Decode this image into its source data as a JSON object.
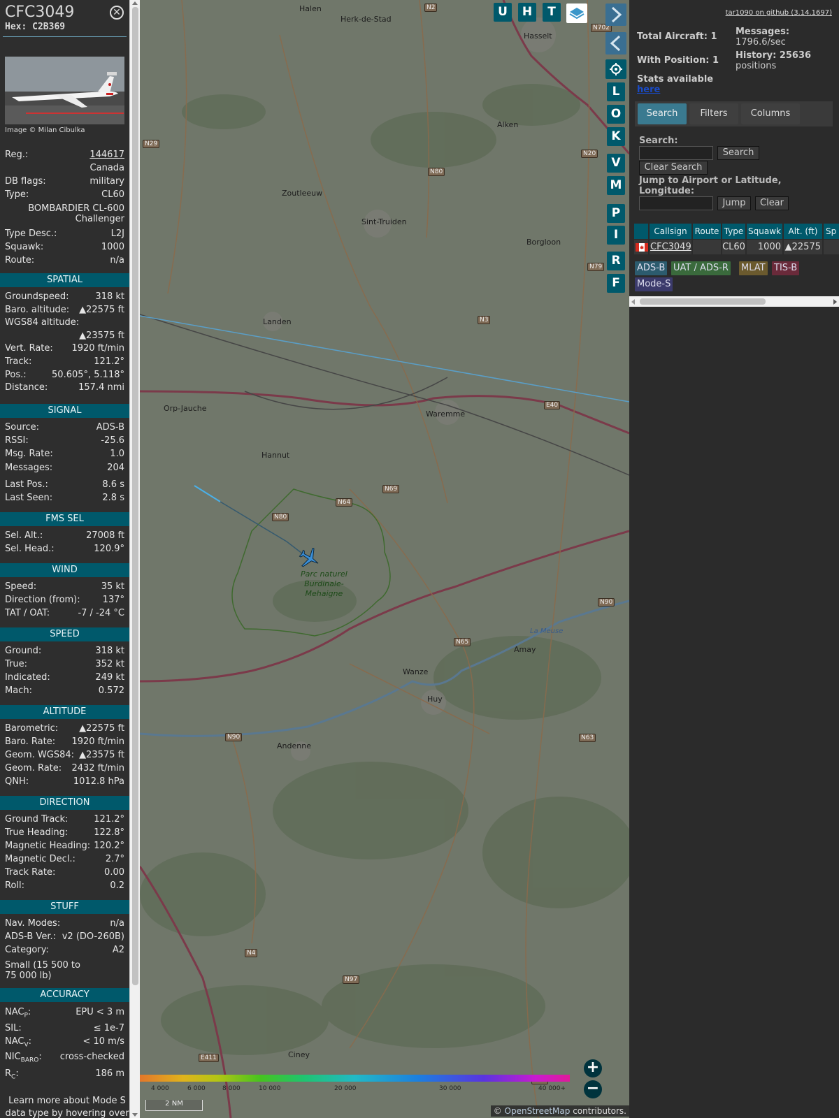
{
  "aircraft": {
    "callsign": "CFC3049",
    "hex_label": "Hex:",
    "hex": "C2B369",
    "image_credit": "Image © Milan Cibulka",
    "reg_label": "Reg.:",
    "reg": "144617",
    "country": "Canada",
    "db_flags_label": "DB flags:",
    "db_flags": "military",
    "type_label": "Type:",
    "type": "CL60",
    "type_full": "BOMBARDIER CL-600 Challenger",
    "type_desc_label": "Type Desc.:",
    "type_desc": "L2J",
    "squawk_label": "Squawk:",
    "squawk": "1000",
    "route_label": "Route:",
    "route": "n/a"
  },
  "sections": {
    "spatial": "SPATIAL",
    "signal": "SIGNAL",
    "fms": "FMS SEL",
    "wind": "WIND",
    "speed": "SPEED",
    "altitude": "ALTITUDE",
    "direction": "DIRECTION",
    "stuff": "STUFF",
    "accuracy": "ACCURACY"
  },
  "spatial": [
    {
      "k": "Groundspeed:",
      "v": "318 kt"
    },
    {
      "k": "Baro. altitude:",
      "v": "▲22575 ft"
    },
    {
      "k": "WGS84 altitude:",
      "v": ""
    },
    {
      "k": "",
      "v": "▲23575 ft"
    },
    {
      "k": "Vert. Rate:",
      "v": "1920 ft/min"
    },
    {
      "k": "Track:",
      "v": "121.2°"
    },
    {
      "k": "Pos.:",
      "v": "50.605°, 5.118°"
    },
    {
      "k": "Distance:",
      "v": "157.4 nmi"
    }
  ],
  "signal": [
    {
      "k": "Source:",
      "v": "ADS-B"
    },
    {
      "k": "RSSI:",
      "v": "-25.6"
    },
    {
      "k": "Msg. Rate:",
      "v": "1.0"
    },
    {
      "k": "Messages:",
      "v": "204"
    },
    {
      "k": "Last Pos.:",
      "v": "8.6 s"
    },
    {
      "k": "Last Seen:",
      "v": "2.8 s"
    }
  ],
  "fms": [
    {
      "k": "Sel. Alt.:",
      "v": "27008 ft"
    },
    {
      "k": "Sel. Head.:",
      "v": "120.9°"
    }
  ],
  "wind": [
    {
      "k": "Speed:",
      "v": "35 kt"
    },
    {
      "k": "Direction (from):",
      "v": "137°"
    },
    {
      "k": "TAT / OAT:",
      "v": "-7 / -24 °C"
    }
  ],
  "speed": [
    {
      "k": "Ground:",
      "v": "318 kt"
    },
    {
      "k": "True:",
      "v": "352 kt"
    },
    {
      "k": "Indicated:",
      "v": "249 kt"
    },
    {
      "k": "Mach:",
      "v": "0.572"
    }
  ],
  "altitude": [
    {
      "k": "Barometric:",
      "v": "▲22575 ft"
    },
    {
      "k": "Baro. Rate:",
      "v": "1920 ft/min"
    },
    {
      "k": "Geom. WGS84:",
      "v": "▲23575 ft"
    },
    {
      "k": "Geom. Rate:",
      "v": "2432 ft/min"
    },
    {
      "k": "QNH:",
      "v": "1012.8 hPa"
    }
  ],
  "direction": [
    {
      "k": "Ground Track:",
      "v": "121.2°"
    },
    {
      "k": "True Heading:",
      "v": "122.8°"
    },
    {
      "k": "Magnetic Heading:",
      "v": "120.2°"
    },
    {
      "k": "Magnetic Decl.:",
      "v": "2.7°"
    },
    {
      "k": "Track Rate:",
      "v": "0.00"
    },
    {
      "k": "Roll:",
      "v": "0.2"
    }
  ],
  "stuff": [
    {
      "k": "Nav. Modes:",
      "v": "n/a"
    },
    {
      "k": "ADS-B Ver.:",
      "v": "v2 (DO-260B)"
    },
    {
      "k": "Category:",
      "v": "A2"
    }
  ],
  "category_desc_1": "Small (15 500 to",
  "category_desc_2": "75 000 lb)",
  "accuracy": {
    "nacp_k": "NAC",
    "nacp_sub": "P",
    "nacp_v": "EPU < 3 m",
    "sil_k": "SIL:",
    "sil_v": "≤ 1e-7",
    "nacv_k": "NAC",
    "nacv_sub": "V",
    "nacv_v": "< 10 m/s",
    "nicbaro_k": "NIC",
    "nicbaro_sub": "BARO",
    "nicbaro_v": "cross-checked",
    "rc_k": "R",
    "rc_sub": "C",
    "rc_v": "186 m"
  },
  "footer_note_1": "Learn more about Mode S",
  "footer_note_2": "data type by hovering over",
  "map": {
    "towns": [
      {
        "name": "Halen"
      },
      {
        "name": "Herk-de-Stad"
      },
      {
        "name": "Hasselt"
      },
      {
        "name": "Alken"
      },
      {
        "name": "Zoutleeuw"
      },
      {
        "name": "Sint-Truiden"
      },
      {
        "name": "Borgloon"
      },
      {
        "name": "Landen"
      },
      {
        "name": "Orp-Jauche"
      },
      {
        "name": "Waremme"
      },
      {
        "name": "Hannut"
      },
      {
        "name": "Wanze"
      },
      {
        "name": "Huy"
      },
      {
        "name": "Amay"
      },
      {
        "name": "Andenne"
      },
      {
        "name": "Ciney"
      }
    ],
    "park_1": "Parc naturel",
    "park_2": "Burdinale-",
    "park_3": "Mehaigne",
    "river": "La Meuse",
    "roads": [
      "N2",
      "N702",
      "N29",
      "N20",
      "N80",
      "N79",
      "N3",
      "E40",
      "N69",
      "N64",
      "N80",
      "N90",
      "N65",
      "N90",
      "N63",
      "N4",
      "N97",
      "N63",
      "E411"
    ],
    "buttons_top": [
      "U",
      "H",
      "T"
    ],
    "buttons_side": [
      "L",
      "O",
      "K",
      "V",
      "M",
      "P",
      "I",
      "R",
      "F"
    ],
    "scale_label": "2 NM",
    "legend_ticks": [
      "4 000",
      "6 000",
      "8 000",
      "10 000",
      "20 000",
      "30 000",
      "40 000+"
    ],
    "attribution_pre": "© ",
    "attribution_link": "OpenStreetMap",
    "attribution_post": " contributors."
  },
  "side": {
    "github": "tar1090 on github (3.14.1697)",
    "total_label": "Total Aircraft: 1",
    "with_pos_label": "With Position: 1",
    "messages_label": "Messages:",
    "messages_rate": "1796.6/sec",
    "history_label": "History: 25636",
    "history_unit": "positions",
    "stats_label": "Stats available",
    "stats_link": "here",
    "tabs": [
      "Search",
      "Filters",
      "Columns"
    ],
    "search_label": "Search:",
    "search_button": "Search",
    "clear_search_button": "Clear Search",
    "jump_label_1": "Jump to Airport or Latitude,",
    "jump_label_2": "Longitude:",
    "jump_button": "Jump",
    "clear_button": "Clear",
    "table_headers": [
      "Callsign",
      "Route",
      "Type",
      "Squawk",
      "Alt. (ft)",
      "Sp"
    ],
    "table_row": {
      "callsign": "CFC3049",
      "route": "",
      "type": "CL60",
      "squawk": "1000",
      "alt": "▲22575"
    },
    "badges": [
      "ADS-B",
      "UAT / ADS-R",
      "MLAT",
      "TIS-B",
      "Mode-S"
    ]
  },
  "colors": {
    "accent": "#00596b",
    "adsb": "#2c5b6e",
    "uat": "#3a6a3c",
    "mlat": "#6b5a2e",
    "tisb": "#6a2a3a",
    "modes": "#3b3a6b"
  }
}
